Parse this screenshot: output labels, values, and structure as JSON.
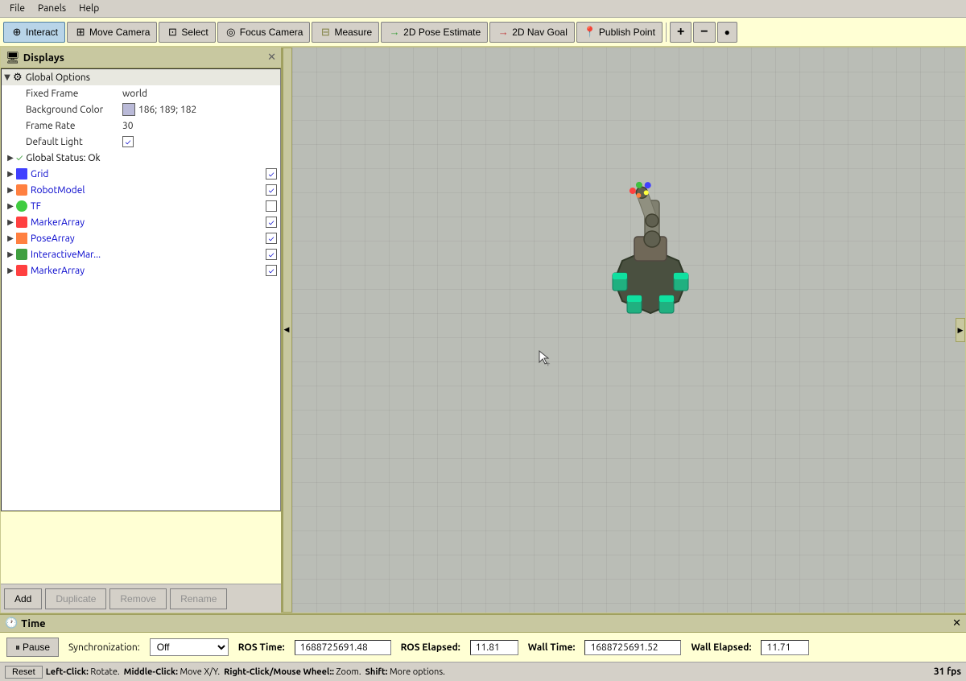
{
  "menubar": {
    "items": [
      "File",
      "Panels",
      "Help"
    ]
  },
  "toolbar": {
    "buttons": [
      {
        "id": "interact",
        "label": "Interact",
        "icon": "⊕",
        "active": true
      },
      {
        "id": "move-camera",
        "label": "Move Camera",
        "icon": "⊞",
        "active": false
      },
      {
        "id": "select",
        "label": "Select",
        "icon": "⊡",
        "active": false
      },
      {
        "id": "focus-camera",
        "label": "Focus Camera",
        "icon": "◎",
        "active": false
      },
      {
        "id": "measure",
        "label": "Measure",
        "icon": "⊟",
        "active": false
      },
      {
        "id": "pose-estimate",
        "label": "2D Pose Estimate",
        "icon": "→",
        "active": false
      },
      {
        "id": "nav-goal",
        "label": "2D Nav Goal",
        "icon": "→",
        "active": false
      },
      {
        "id": "publish-point",
        "label": "Publish Point",
        "icon": "📍",
        "active": false
      }
    ],
    "zoom_in": "+",
    "zoom_out": "−",
    "zoom_reset": "●"
  },
  "displays": {
    "title": "Displays",
    "global_options": {
      "label": "Global Options",
      "fixed_frame": {
        "label": "Fixed Frame",
        "value": "world"
      },
      "background_color": {
        "label": "Background Color",
        "value": "186; 189; 182",
        "swatch": "#babad8"
      },
      "frame_rate": {
        "label": "Frame Rate",
        "value": "30"
      },
      "default_light": {
        "label": "Default Light",
        "checked": true
      }
    },
    "global_status": {
      "label": "Global Status: Ok",
      "checked": true
    },
    "items": [
      {
        "id": "grid",
        "label": "Grid",
        "checked": true,
        "color": "#4040ff",
        "expanded": false
      },
      {
        "id": "robot-model",
        "label": "RobotModel",
        "checked": true,
        "color": "#ff8040",
        "expanded": false
      },
      {
        "id": "tf",
        "label": "TF",
        "checked": false,
        "color": "#40cc40",
        "expanded": false
      },
      {
        "id": "marker-array-1",
        "label": "MarkerArray",
        "checked": true,
        "color": "#ff4040",
        "expanded": false
      },
      {
        "id": "pose-array",
        "label": "PoseArray",
        "checked": true,
        "color": "#ff8040",
        "expanded": false
      },
      {
        "id": "interactive-mar",
        "label": "InteractiveMar...",
        "checked": true,
        "color": "#40a040",
        "expanded": false
      },
      {
        "id": "marker-array-2",
        "label": "MarkerArray",
        "checked": true,
        "color": "#ff4040",
        "expanded": false
      }
    ],
    "buttons": {
      "add": "Add",
      "duplicate": "Duplicate",
      "remove": "Remove",
      "rename": "Rename"
    }
  },
  "time": {
    "title": "Time",
    "pause_label": "Pause",
    "sync_label": "Synchronization:",
    "sync_value": "Off",
    "ros_time_label": "ROS Time:",
    "ros_time_value": "1688725691.48",
    "ros_elapsed_label": "ROS Elapsed:",
    "ros_elapsed_value": "11.81",
    "wall_time_label": "Wall Time:",
    "wall_time_value": "1688725691.52",
    "wall_elapsed_label": "Wall Elapsed:",
    "wall_elapsed_value": "11.71"
  },
  "statusbar": {
    "reset_label": "Reset",
    "help_text": "Left-Click: Rotate.  Middle-Click: Move X/Y.  Right-Click/Mouse Wheel:: Zoom.  Shift: More options.",
    "fps": "31 fps"
  },
  "icons": {
    "checkmark": "✓",
    "arrow_right": "▶",
    "arrow_down": "▼",
    "close": "✕",
    "pause": "⏸",
    "clock": "🕐"
  }
}
